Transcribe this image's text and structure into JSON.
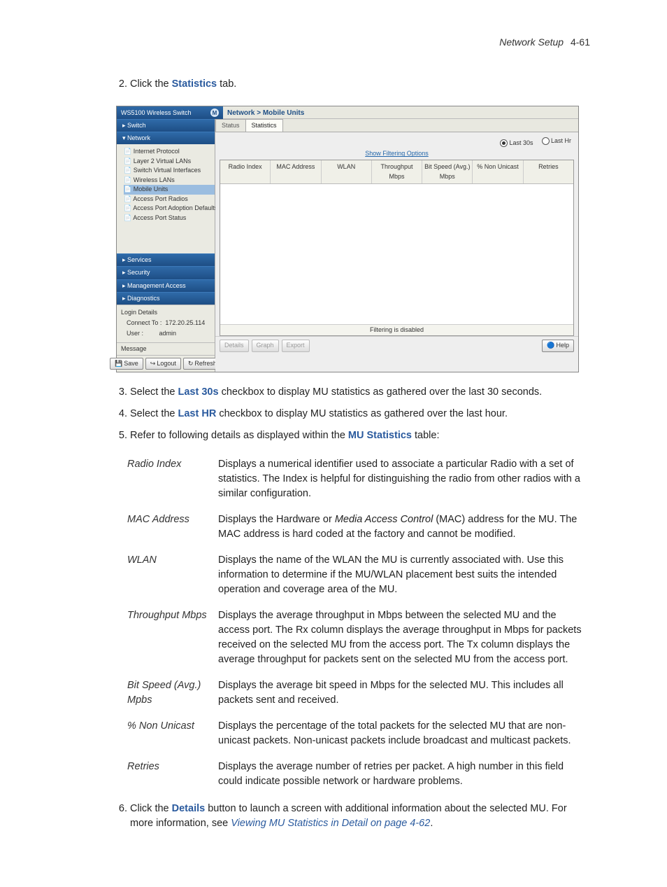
{
  "header": {
    "section": "Network Setup",
    "page": "4-61"
  },
  "steps_a": {
    "s2_pre": "Click the ",
    "s2_bold": "Statistics",
    "s2_post": " tab."
  },
  "shot": {
    "product": "WS5100 Wireless Switch",
    "logo": "M",
    "breadcrumb": "Network > Mobile Units",
    "tabs": {
      "inactive": "Status",
      "active": "Statistics"
    },
    "time": {
      "opt1": "Last 30s",
      "opt2": "Last Hr"
    },
    "filter_link": "Show Filtering Options",
    "cols": {
      "c1": "Radio Index",
      "c2": "MAC Address",
      "c3": "WLAN",
      "c4": "Throughput Mbps",
      "c5": "Bit Speed (Avg.) Mbps",
      "c6": "% Non Unicast",
      "c7": "Retries"
    },
    "filter_status": "Filtering is disabled",
    "nav": {
      "switch": "Switch",
      "network": "Network",
      "items": {
        "ip": "Internet Protocol",
        "l2": "Layer 2 Virtual LANs",
        "svi": "Switch Virtual Interfaces",
        "wlan": "Wireless LANs",
        "mu": "Mobile Units",
        "apr": "Access Port Radios",
        "apd": "Access Port Adoption Defaults",
        "aps": "Access Port Status"
      },
      "services": "Services",
      "security": "Security",
      "mgmt": "Management Access",
      "diag": "Diagnostics"
    },
    "login": {
      "title": "Login Details",
      "connect_k": "Connect To :",
      "connect_v": "172.20.25.114",
      "user_k": "User :",
      "user_v": "admin",
      "msg": "Message"
    },
    "btns": {
      "save": "Save",
      "logout": "Logout",
      "refresh": "Refresh",
      "details": "Details",
      "graph": "Graph",
      "export": "Export",
      "help": "Help"
    }
  },
  "steps_b": {
    "s3_pre": "Select the ",
    "s3_bold": "Last 30s",
    "s3_post": " checkbox to display MU statistics as gathered over the last 30 seconds.",
    "s4_pre": "Select the ",
    "s4_bold": "Last HR",
    "s4_post": " checkbox to display MU statistics as gathered over the last hour.",
    "s5_pre": "Refer to following details as displayed within the ",
    "s5_bold": "MU Statistics",
    "s5_post": " table:"
  },
  "defs": {
    "t1": "Radio Index",
    "d1": "Displays a numerical identifier used to associate a particular Radio with a set of statistics. The Index is helpful for distinguishing the radio from other radios with a similar configuration.",
    "t2": "MAC Address",
    "d2a": "Displays the Hardware or ",
    "d2i": "Media Access Control",
    "d2b": " (MAC) address for the MU. The MAC address is hard coded at the factory and cannot be modified.",
    "t3": "WLAN",
    "d3": "Displays the name of the WLAN the MU is currently associated with. Use this information to determine if the MU/WLAN placement best suits the intended operation and coverage area of the MU.",
    "t4": "Throughput Mbps",
    "d4": "Displays the average throughput in Mbps between the selected MU and the access port. The Rx column displays the average throughput in Mbps for packets received on the selected MU from the access port. The Tx column displays the average throughput for packets sent on the selected MU from the access port.",
    "t5": "Bit Speed (Avg.) Mpbs",
    "d5": "Displays the average bit speed in Mbps for the selected MU. This includes all packets sent and received.",
    "t6": "% Non Unicast",
    "d6": "Displays the percentage of the total packets for the selected MU that are non-unicast packets. Non-unicast packets include broadcast and multicast packets.",
    "t7": "Retries",
    "d7": "Displays the average number of retries per packet. A high number in this field could indicate possible network or hardware problems."
  },
  "step6": {
    "pre": "Click the ",
    "bold": "Details",
    "mid": " button to launch a screen with additional information about the selected MU. For more information, see ",
    "link": "Viewing MU Statistics in Detail on page 4-62",
    "end": "."
  }
}
